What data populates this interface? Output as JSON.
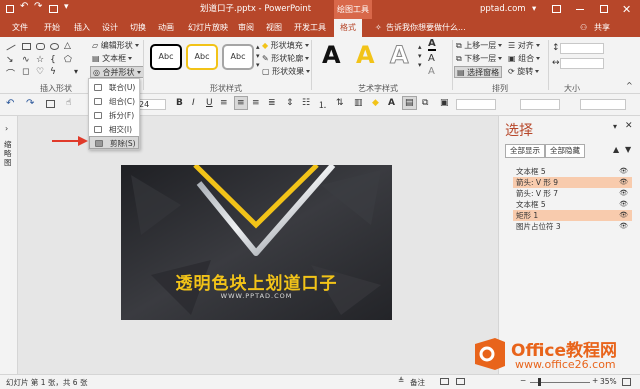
{
  "titlebar": {
    "filename": "划道口子.pptx - PowerPoint",
    "context_tab": "绘图工具",
    "account": "pptad.com",
    "account_caret": "▾"
  },
  "tabs": [
    "文件",
    "开始",
    "插入",
    "设计",
    "切换",
    "动画",
    "幻灯片放映",
    "审阅",
    "视图",
    "开发工具",
    "格式"
  ],
  "tell_me": "告诉我你想要做什么...",
  "share": "共享",
  "ribbon": {
    "insert_shapes": {
      "label": "插入形状",
      "edit_shape": "编辑形状",
      "textbox": "文本框",
      "merge_shapes": "合并形状"
    },
    "shape_styles": {
      "label": "形状样式",
      "sample": "Abc",
      "fill": "形状填充",
      "outline": "形状轮廓",
      "effect": "形状效果"
    },
    "wordart": {
      "label": "艺术字样式",
      "letter": "A"
    },
    "arrange": {
      "label": "排列",
      "bring_forward": "上移一层",
      "send_backward": "下移一层",
      "selection_pane": "选择窗格",
      "align": "对齐",
      "group": "组合",
      "rotate": "旋转"
    },
    "size": {
      "label": "大小"
    }
  },
  "font_size": "24",
  "merge_menu": [
    "联合(U)",
    "组合(C)",
    "拆分(F)",
    "相交(I)",
    "剪除(S)"
  ],
  "side_tab": "缩略图",
  "slide": {
    "headline": "透明色块上划道口子",
    "url": "WWW.PPTAD.COM"
  },
  "selection_pane": {
    "title": "选择",
    "show_all": "全部显示",
    "hide_all": "全部隐藏",
    "items": [
      {
        "label": "文本框 5",
        "selected": false
      },
      {
        "label": "箭头: V 形 9",
        "selected": true
      },
      {
        "label": "箭头: V 形 7",
        "selected": false
      },
      {
        "label": "文本框 5",
        "selected": false
      },
      {
        "label": "矩形 1",
        "selected": true
      },
      {
        "label": "图片占位符 3",
        "selected": false
      }
    ]
  },
  "status": {
    "slide_info": "幻灯片 第 1 张，共 6 张",
    "notes": "备注",
    "zoom": "35%"
  },
  "logo": {
    "brand": "Office教程网",
    "url": "www.office26.com"
  },
  "colors": {
    "accent": "#b7472a",
    "slide_bg": "#2c2d31",
    "headline": "#f2c318",
    "selected_item": "#f8cbad",
    "logo_orange": "#e8641b"
  }
}
